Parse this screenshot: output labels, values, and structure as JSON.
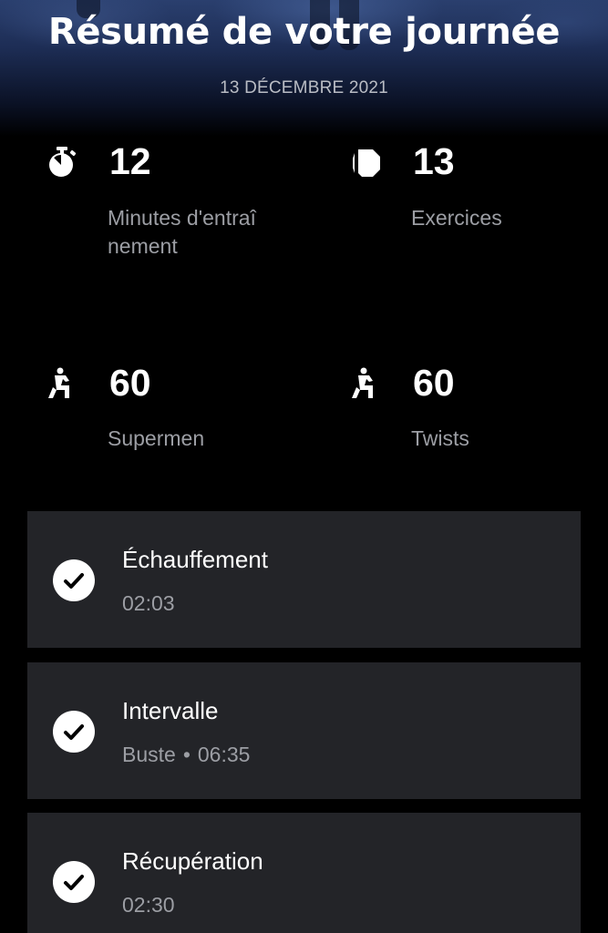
{
  "header": {
    "title": "Résumé de votre journée",
    "date": "13 DÉCEMBRE 2021"
  },
  "stats": [
    {
      "icon": "stopwatch-icon",
      "value": "12",
      "label": "Minutes d'entraînement"
    },
    {
      "icon": "exercise-block-icon",
      "value": "13",
      "label": "Exercices"
    },
    {
      "icon": "exercise-figure-icon",
      "value": "60",
      "label": "Supermen"
    },
    {
      "icon": "exercise-figure-icon",
      "value": "60",
      "label": "Twists"
    }
  ],
  "sessions": [
    {
      "name": "Échauffement",
      "duration": "02:03",
      "completed": true
    },
    {
      "name": "Intervalle",
      "category": "Buste",
      "separator": "•",
      "duration": "06:35",
      "completed": true
    },
    {
      "name": "Récupération",
      "duration": "02:30",
      "completed": true
    }
  ]
}
